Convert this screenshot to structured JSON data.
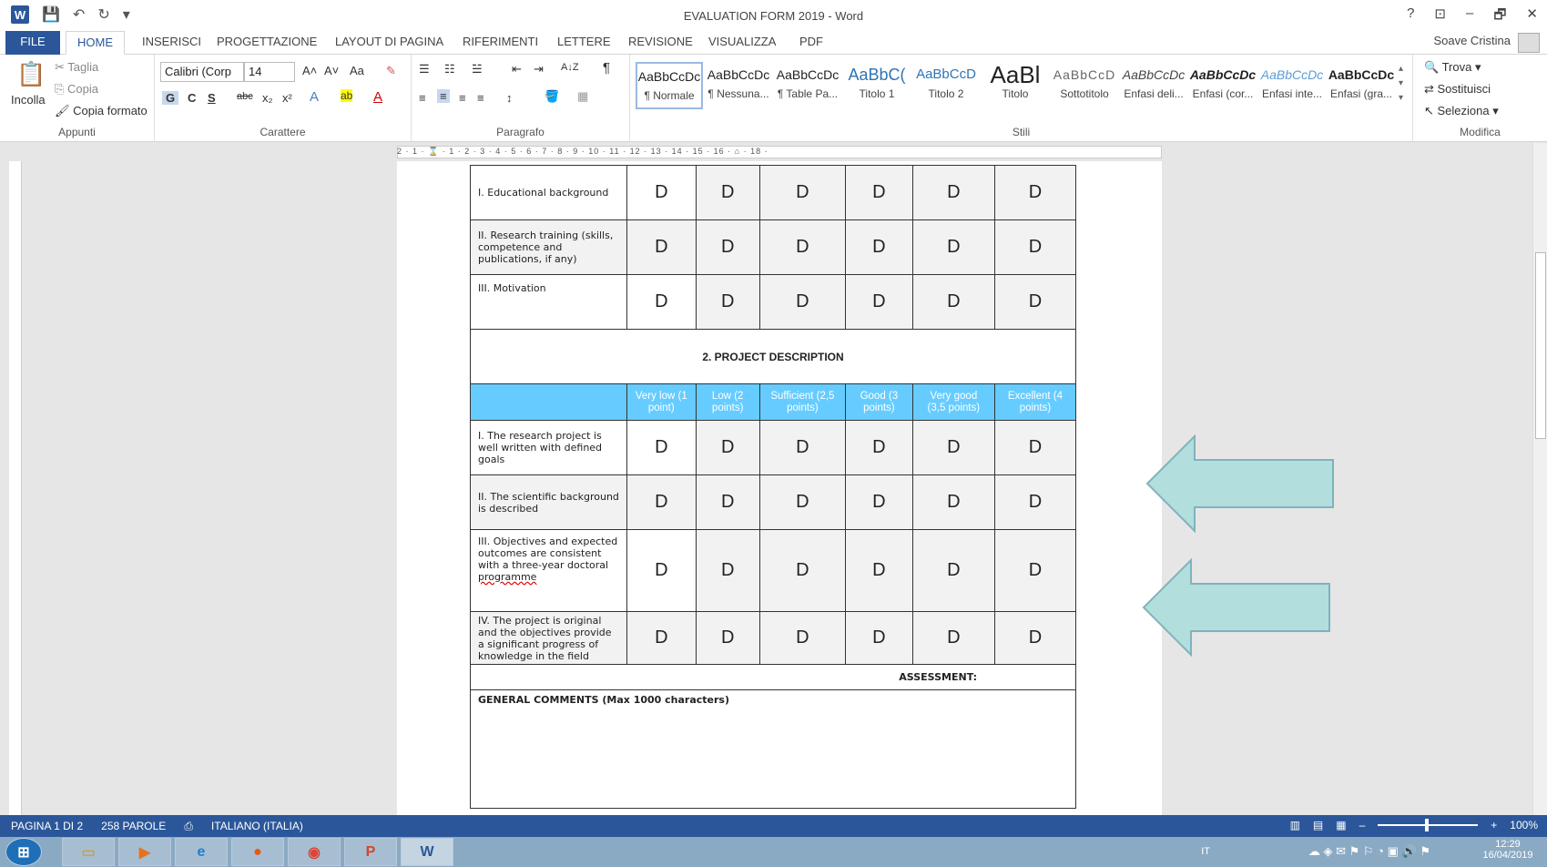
{
  "window": {
    "title": "EVALUATION FORM 2019 - Word",
    "app_icon": "W",
    "help": "?",
    "restore_ribbon": "⊡",
    "minimize": "–",
    "maximize": "🗗",
    "close": "✕"
  },
  "tabs": {
    "file": "FILE",
    "items": [
      "HOME",
      "INSERISCI",
      "PROGETTAZIONE",
      "LAYOUT DI PAGINA",
      "RIFERIMENTI",
      "LETTERE",
      "REVISIONE",
      "VISUALIZZA",
      "PDF"
    ],
    "user": "Soave Cristina"
  },
  "ribbon": {
    "clipboard": {
      "paste": "Incolla",
      "cut": "Taglia",
      "copy": "Copia",
      "format_painter": "Copia formato",
      "label": "Appunti"
    },
    "font": {
      "family": "Calibri (Corp",
      "size": "14",
      "label": "Carattere",
      "bold": "G",
      "italic": "C",
      "underline": "S",
      "strike": "abc",
      "sub": "x₂",
      "sup": "x²",
      "grow": "A˄",
      "shrink": "A˅",
      "case": "Aa"
    },
    "paragraph": {
      "label": "Paragrafo",
      "pilcrow": "¶",
      "sort": "A↓Z"
    },
    "styles": {
      "label": "Stili",
      "items": [
        {
          "preview": "AaBbCcDc",
          "name": "¶ Normale"
        },
        {
          "preview": "AaBbCcDc",
          "name": "¶ Nessuna..."
        },
        {
          "preview": "AaBbCcDc",
          "name": "¶ Table Pa..."
        },
        {
          "preview": "AaBbC(",
          "name": "Titolo 1"
        },
        {
          "preview": "AaBbCcD",
          "name": "Titolo 2"
        },
        {
          "preview": "AaBl",
          "name": "Titolo"
        },
        {
          "preview": "AaBbCcD",
          "name": "Sottotitolo"
        },
        {
          "preview": "AaBbCcDc",
          "name": "Enfasi deli..."
        },
        {
          "preview": "AaBbCcDc",
          "name": "Enfasi (cor..."
        },
        {
          "preview": "AaBbCcDc",
          "name": "Enfasi inte..."
        },
        {
          "preview": "AaBbCcDc",
          "name": "Enfasi (gra..."
        }
      ]
    },
    "edit": {
      "find": "Trova",
      "replace": "Sostituisci",
      "select": "Seleziona",
      "label": "Modifica"
    }
  },
  "ruler": {
    "numbers": "2 · 1 · ⌛ · 1 · 2 · 3 · 4 · 5 · 6 · 7 · 8 · 9 · 10 · 11 · 12 · 13 · 14 · 15 · 16 · ⌂ · 18 ·"
  },
  "document": {
    "section1_rows": [
      {
        "label": "I. Educational background",
        "marks": [
          "D",
          "D",
          "D",
          "D",
          "D",
          "D"
        ]
      },
      {
        "label": "II. Research training (skills, competence and publications, if any)",
        "marks": [
          "D",
          "D",
          "D",
          "D",
          "D",
          "D"
        ]
      },
      {
        "label": "III.  Motivation",
        "marks": [
          "D",
          "D",
          "D",
          "D",
          "D",
          "D"
        ]
      }
    ],
    "section2_title": "2. PROJECT DESCRIPTION",
    "scale": [
      "Very low (1 point)",
      "Low (2 points)",
      "Sufficient (2,5 points)",
      "Good (3 points)",
      "Very good (3,5 points)",
      "Excellent (4 points)"
    ],
    "section2_rows": [
      {
        "label": "I. The research project is well written with defined goals",
        "marks": [
          "D",
          "D",
          "D",
          "D",
          "D",
          "D"
        ]
      },
      {
        "label": "II. The scientific background is described",
        "marks": [
          "D",
          "D",
          "D",
          "D",
          "D",
          "D"
        ]
      },
      {
        "label_pre": "III. Objectives and expected outcomes are consistent with a three-year doctoral ",
        "label_err": "programme",
        "marks": [
          "D",
          "D",
          "D",
          "D",
          "D",
          "D"
        ]
      },
      {
        "label": "IV. The project is original and the objectives provide a significant progress of knowledge in the field",
        "marks": [
          "D",
          "D",
          "D",
          "D",
          "D",
          "D"
        ]
      }
    ],
    "assessment": "ASSESSMENT:",
    "comments": "GENERAL COMMENTS (Max 1000 characters)"
  },
  "statusbar": {
    "page": "PAGINA 1 DI 2",
    "words": "258 PAROLE",
    "language": "ITALIANO (ITALIA)",
    "zoom": "100%"
  },
  "taskbar": {
    "lang": "IT",
    "time": "12:29",
    "date": "16/04/2019"
  },
  "colors": {
    "accent": "#2b579a",
    "table_header": "#66ccff",
    "arrow_fill": "#b2dede",
    "arrow_stroke": "#7fb3bc"
  }
}
